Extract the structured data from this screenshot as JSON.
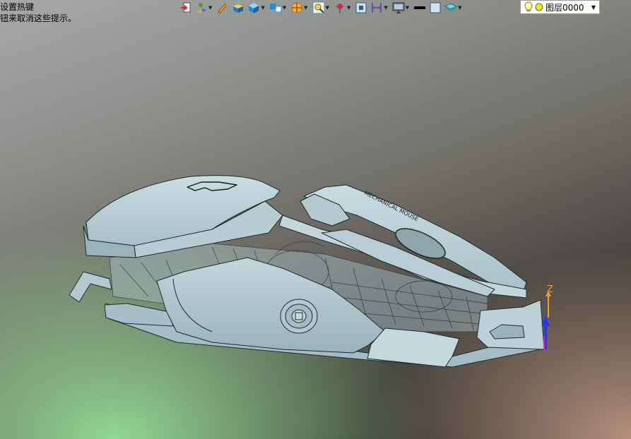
{
  "hints": {
    "line1": "设置热键",
    "line2": "钮来取消这些提示。"
  },
  "toolbar": {
    "buttons": [
      {
        "name": "exit-sketch-icon",
        "has_menu": false
      },
      {
        "name": "user-view-icon",
        "has_menu": true
      },
      {
        "name": "pen-icon",
        "has_menu": false
      },
      {
        "name": "solid-block-icon",
        "has_menu": false
      },
      {
        "name": "shaded-cube-icon",
        "has_menu": true
      },
      {
        "name": "multi-body-icon",
        "has_menu": true
      },
      {
        "name": "section-view-icon",
        "has_menu": true
      },
      {
        "name": "zoom-box-icon",
        "has_menu": true
      },
      {
        "name": "pin-icon",
        "has_menu": true
      },
      {
        "name": "frame-icon",
        "has_menu": false
      },
      {
        "name": "dimension-icon",
        "has_menu": true
      },
      {
        "name": "monitor-icon",
        "has_menu": true
      },
      {
        "name": "black-line-icon",
        "has_menu": false
      },
      {
        "name": "light-square-icon",
        "has_menu": false
      },
      {
        "name": "layers-stack-icon",
        "has_menu": true
      }
    ]
  },
  "layer_select": {
    "value": "图层0000"
  },
  "model": {
    "engraving": "MECHANICAL MOUSE",
    "triad_z": "Z"
  },
  "colors": {
    "shell": "#b8cdd4",
    "shell_dark": "#8ea6ae",
    "edge": "#1e2a2e",
    "axis_z": "#e7a02a",
    "axis_blue": "#2a3ae8",
    "axis_magenta": "#c02ad0"
  }
}
